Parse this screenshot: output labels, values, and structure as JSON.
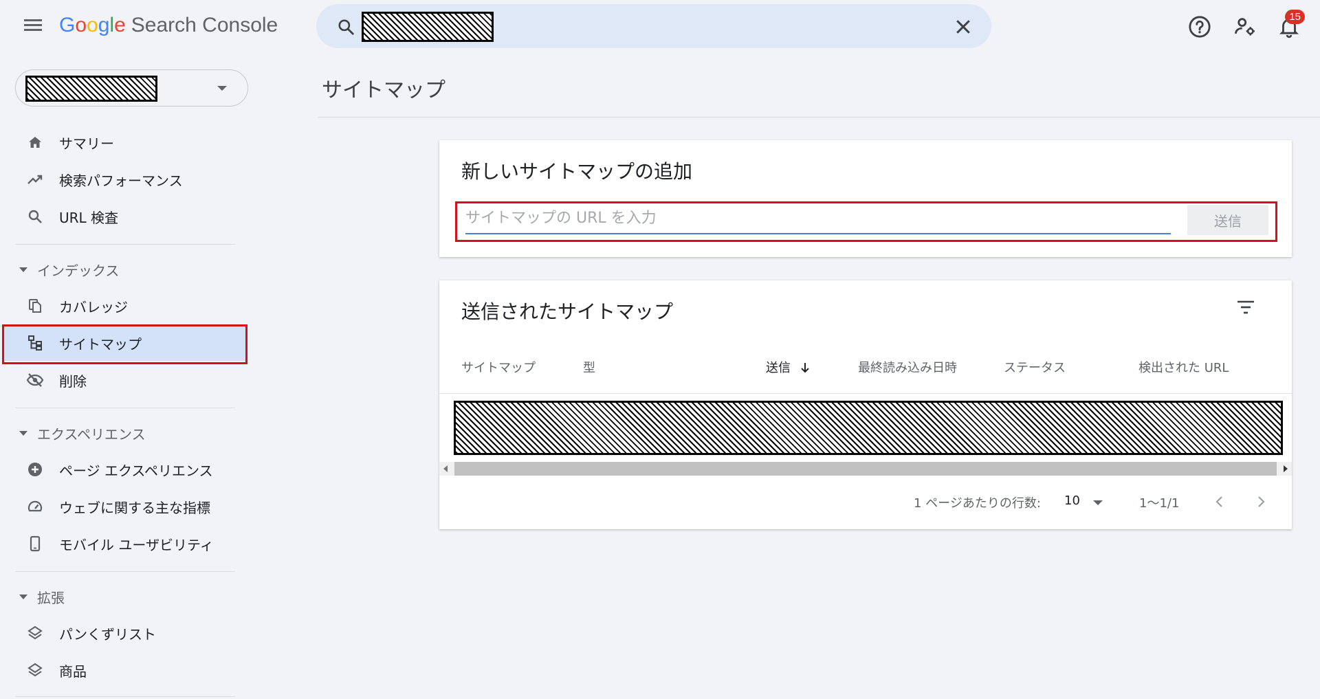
{
  "app": {
    "logo_google": [
      "G",
      "o",
      "o",
      "g",
      "l",
      "e"
    ],
    "logo_product": "Search Console",
    "notifications_count": "15"
  },
  "colors": {
    "accent_blue": "#4a7fd6",
    "active_nav_bg": "#d3e1f9",
    "highlight_red": "#d3111a",
    "badge_red": "#d93025"
  },
  "sidebar": {
    "nav_top": [
      {
        "label": "サマリー",
        "icon": "home-icon"
      },
      {
        "label": "検索パフォーマンス",
        "icon": "trending-up-icon"
      },
      {
        "label": "URL 検査",
        "icon": "search-icon"
      }
    ],
    "sections": [
      {
        "label": "インデックス",
        "items": [
          {
            "label": "カバレッジ",
            "icon": "copy-pages-icon"
          },
          {
            "label": "サイトマップ",
            "icon": "sitemap-icon",
            "active": true
          },
          {
            "label": "削除",
            "icon": "visibility-off-icon"
          }
        ]
      },
      {
        "label": "エクスペリエンス",
        "items": [
          {
            "label": "ページ エクスペリエンス",
            "icon": "add-circle-icon"
          },
          {
            "label": "ウェブに関する主な指標",
            "icon": "speed-gauge-icon"
          },
          {
            "label": "モバイル ユーザビリティ",
            "icon": "smartphone-icon"
          }
        ]
      },
      {
        "label": "拡張",
        "items": [
          {
            "label": "パンくずリスト",
            "icon": "layers-icon"
          },
          {
            "label": "商品",
            "icon": "layers-icon"
          }
        ]
      }
    ]
  },
  "main": {
    "page_title": "サイトマップ",
    "add_card": {
      "title": "新しいサイトマップの追加",
      "input_placeholder": "サイトマップの URL を入力",
      "submit_label": "送信"
    },
    "submitted_card": {
      "title": "送信されたサイトマップ",
      "columns": [
        "サイトマップ",
        "型",
        "送信",
        "最終読み込み日時",
        "ステータス",
        "検出された URL"
      ],
      "sorted_column": "送信",
      "rows_per_page_label": "1 ページあたりの行数:",
      "rows_per_page_value": "10",
      "range_label": "1～1/1"
    }
  }
}
